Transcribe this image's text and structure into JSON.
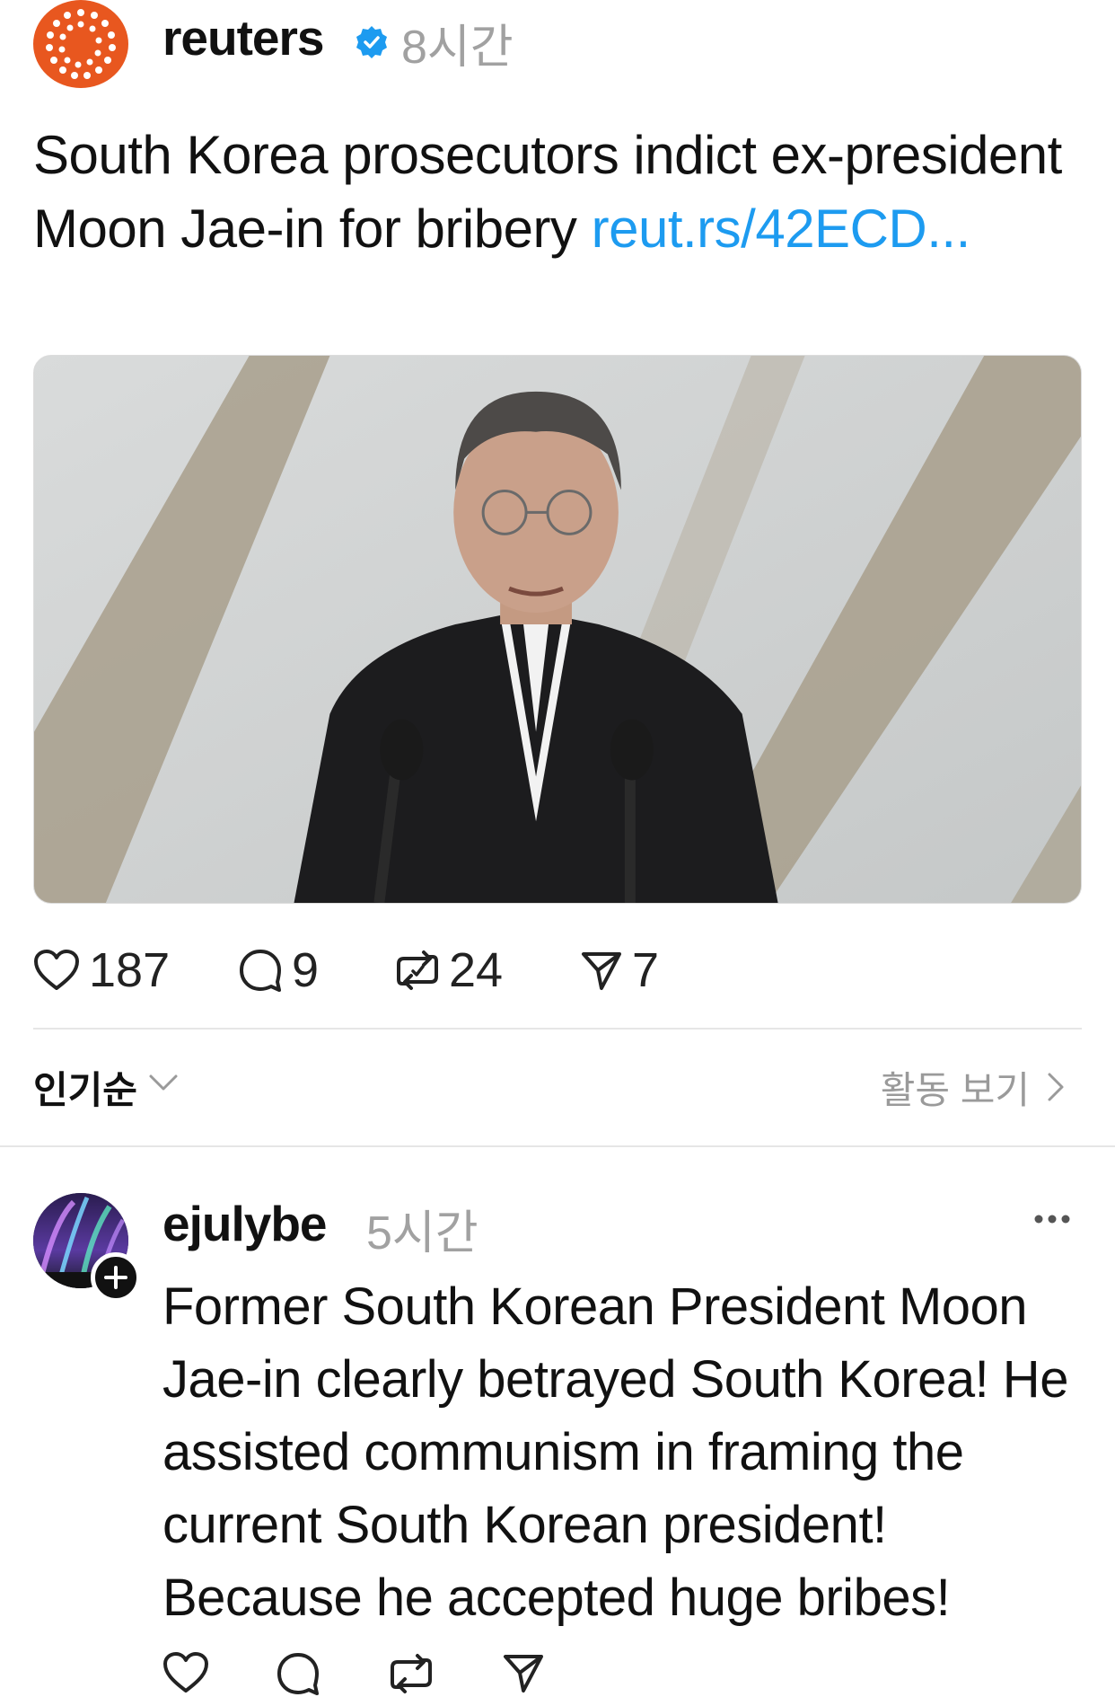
{
  "post": {
    "author": "reuters",
    "time": "8시간",
    "text": "South Korea prosecutors indict ex-president Moon Jae-in for bribery ",
    "link": "reut.rs/42ECD...",
    "image_icon": "photo",
    "stats": {
      "likes": "187",
      "comments": "9",
      "reposts": "24",
      "shares": "7"
    }
  },
  "sort": {
    "label": "인기순",
    "activity": "활동 보기"
  },
  "reply": {
    "author": "ejulybe",
    "time": "5시간",
    "text": "Former South Korean President Moon Jae-in clearly betrayed South Korea! He assisted communism in framing the current South Korean president! Because he accepted huge bribes!"
  },
  "colors": {
    "brand": "#e8571f",
    "link": "#1d9bf0",
    "verified": "#1d9bf0",
    "muted": "#a1a1a1"
  }
}
